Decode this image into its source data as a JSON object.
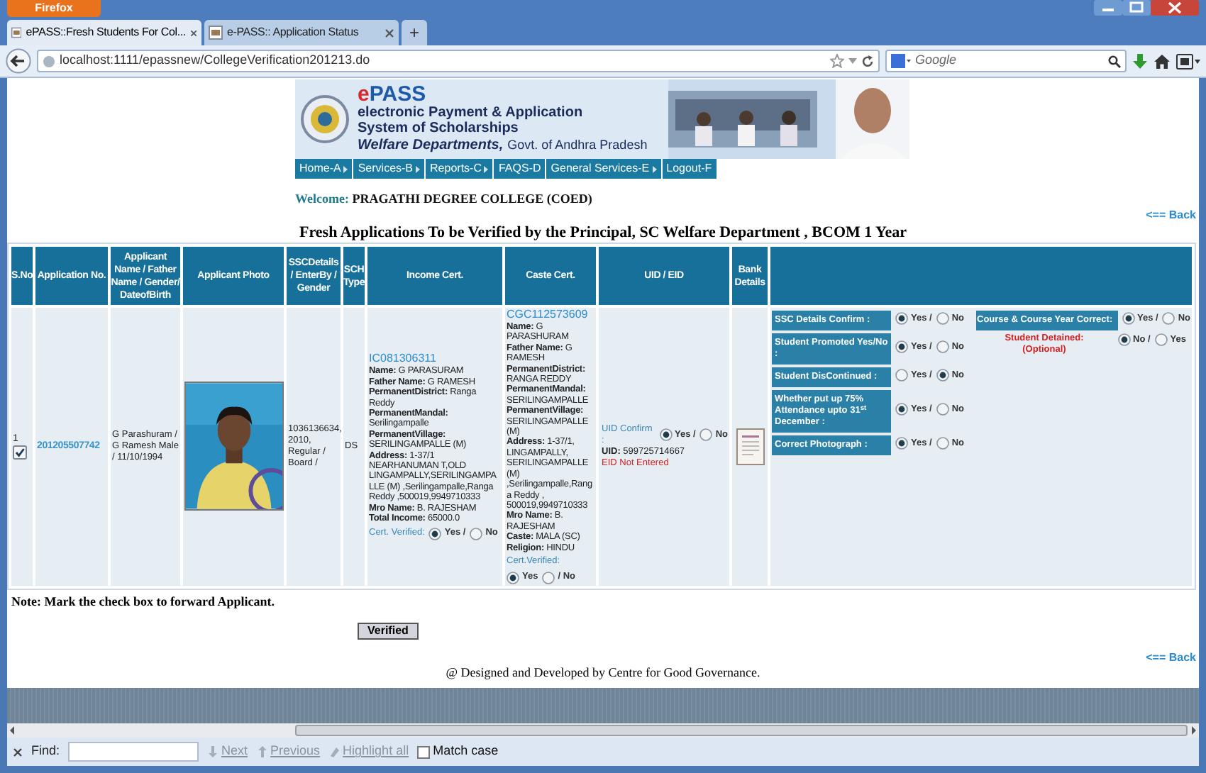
{
  "browser": {
    "app_button": "Firefox",
    "tabs": [
      {
        "title": "ePASS::Fresh Students For Col...",
        "selected": true
      },
      {
        "title": "e-PASS:: Application Status",
        "selected": false
      }
    ],
    "new_tab": "+",
    "url": "localhost:1111/epassnew/CollegeVerification201213.do",
    "search": {
      "placeholder": "Google"
    }
  },
  "banner": {
    "title_prefix": "e",
    "title_main": "PASS",
    "subtitle_lines": [
      "electronic Payment & Application",
      "System of Scholarships"
    ],
    "department": "Welfare Departments,",
    "government": "Govt. of Andhra Pradesh"
  },
  "nav": [
    {
      "label": "Home-A",
      "has_menu": true
    },
    {
      "label": "Services-B",
      "has_menu": true
    },
    {
      "label": "Reports-C",
      "has_menu": true
    },
    {
      "label": "FAQS-D",
      "has_menu": false
    },
    {
      "label": "General Services-E",
      "has_menu": true
    },
    {
      "label": "Logout-F",
      "has_menu": false
    }
  ],
  "welcome": {
    "label": "Welcome:",
    "college": "PRAGATHI DEGREE COLLEGE (COED)"
  },
  "back_link_top": "<== Back",
  "table": {
    "title": "Fresh Applications To be Verified by the Principal, SC Welfare Department , BCOM 1 Year",
    "columns": [
      "S.No",
      "Application No.",
      "Applicant Name / Father Name / Gender/ DateofBirth",
      "Applicant Photo",
      "SSCDetails / EnterBy / Gender",
      "SCH Type",
      "Income Cert.",
      "Caste Cert.",
      "UID / EID",
      "Bank Details"
    ],
    "rows": [
      {
        "sno": "1",
        "checked": true,
        "application_no": "201205507742",
        "applicant": "G Parashuram / G Ramesh Male / 11/10/1994",
        "photo": {
          "kind": "picture"
        },
        "ssc_details": "1036136634, 2010, Regular / Board /",
        "sch_type": "DS",
        "income": {
          "cert_no": "IC081306311",
          "fields": [
            "**Name:** G PARASURAM",
            "**Father Name:** G RAMESH",
            "**PermanentDistrict:** Ranga Reddy",
            "**PermanentMandal:** Serilingampalle",
            "**PermanentVillage:** SERILINGAMPALLE (M)",
            "**Address:** 1-37/1 NEARHANUMAN T,OLD LINGAMPALLY,SERILINGAMPALLE (M) ,Serilingampalle,Ranga Reddy ,500019,9949710333",
            "**Mro Name:** B. RAJESHAM",
            "**Total Income:** 65000.0"
          ],
          "verified_label": "Cert. Verified:",
          "options": [
            {
              "label": "Yes /",
              "selected": true
            },
            {
              "label": "No",
              "selected": false
            }
          ]
        },
        "caste": {
          "cert_no": "CGC112573609",
          "fields": [
            "**Name:** G PARASHURAM",
            "**Father Name:** G RAMESH",
            "**PermanentDistrict:** RANGA REDDY",
            "**PermanentMandal:** SERILINGAMPALLE",
            "**PermanentVillage:** SERILINGAMPALLE (M)",
            "**Address:** 1-37/1, LINGAMPALLY, SERILINGAMPALLE (M) ,Serilingampalle,Ranga Reddy , 500019,9949710333",
            "**Mro Name:** B. RAJESHAM",
            "**Caste:** MALA (SC)",
            "**Religion:** HINDU"
          ],
          "verified_label": "Cert.Verified:",
          "options": [
            {
              "label": "Yes",
              "selected": true
            },
            {
              "label": "/ No",
              "selected": false
            }
          ]
        },
        "uid": {
          "confirm_label": "UID Confirm :",
          "options": [
            {
              "label": "Yes /",
              "selected": true
            },
            {
              "label": "No",
              "selected": false
            }
          ],
          "uid_label": "UID:",
          "uid": "599725714667",
          "eid_status": "EID Not Entered"
        },
        "checks": [
          {
            "label": "SSC Details Confirm :",
            "options": [
              {
                "label": "Yes /",
                "selected": true
              },
              {
                "label": "No",
                "selected": false
              }
            ]
          },
          {
            "label": "Student Promoted Yes/No :",
            "options": [
              {
                "label": "Yes /",
                "selected": true
              },
              {
                "label": "No",
                "selected": false
              }
            ]
          },
          {
            "label": "Student DisContinued :",
            "options": [
              {
                "label": "Yes /",
                "selected": false
              },
              {
                "label": "No",
                "selected": true
              }
            ]
          },
          {
            "label": "Whether put up 75% Attendance upto 31$^{st}$ December :",
            "options": [
              {
                "label": "Yes /",
                "selected": true
              },
              {
                "label": "No",
                "selected": false
              }
            ]
          },
          {
            "label": "Correct Photograph :",
            "options": [
              {
                "label": "Yes /",
                "selected": true
              },
              {
                "label": "No",
                "selected": false
              }
            ]
          }
        ],
        "course_check": {
          "label": "Course & Course Year Correct:",
          "options": [
            {
              "label": "Yes /",
              "selected": true
            },
            {
              "label": "No",
              "selected": false
            }
          ]
        },
        "detained": {
          "label": "Student Detained:",
          "note": "(Optional)",
          "options": [
            {
              "label": "No /",
              "selected": true
            },
            {
              "label": "Yes",
              "selected": false
            }
          ]
        }
      }
    ]
  },
  "note": "Note: Mark the check box to forward Applicant.",
  "verify_button": "Verified",
  "back_link_bottom": "<== Back",
  "footer": "@ Designed and Developed by Centre for Good Governance.",
  "find_bar": {
    "label": "Find:",
    "buttons": [
      {
        "label": "Next",
        "disabled": true
      },
      {
        "label": "Previous",
        "disabled": true
      },
      {
        "label": "Highlight all",
        "disabled": true
      }
    ],
    "match_case": {
      "label": "Match case",
      "checked": false
    }
  }
}
